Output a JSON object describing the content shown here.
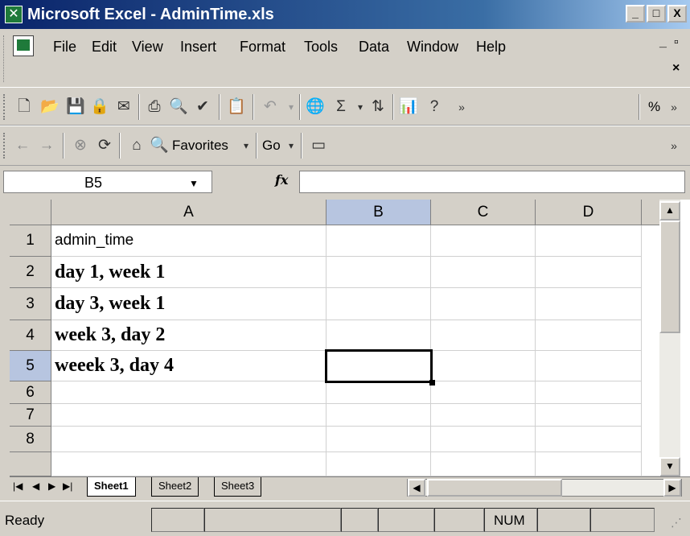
{
  "window": {
    "title": "Microsoft Excel - AdminTime.xls",
    "controls": [
      "_",
      "□",
      "X"
    ]
  },
  "menubar": {
    "items": [
      "File",
      "Edit",
      "View",
      "Insert",
      "Format",
      "Tools",
      "Data",
      "Window",
      "Help"
    ],
    "doc_controls": [
      "_ ",
      "▫",
      "×"
    ]
  },
  "toolbar_standard": {
    "icons": [
      "new-icon",
      "open-icon",
      "save-icon",
      "permission-icon",
      "email-icon",
      "print-icon",
      "print-preview-icon",
      "spelling-icon",
      "paste-icon",
      "undo-icon",
      "hyperlink-icon",
      "autosum-icon",
      "sort-ascending-icon",
      "chart-wizard-icon",
      "help-icon",
      "overflow-icon",
      "percent-icon"
    ],
    "percent_label": "%"
  },
  "toolbar_web": {
    "favorites_label": "Favorites",
    "go_label": "Go"
  },
  "formula_bar": {
    "cell_ref": "B5",
    "fx_label": "fx",
    "formula": ""
  },
  "sheet": {
    "columns": [
      "A",
      "B",
      "C",
      "D"
    ],
    "rows": [
      "1",
      "2",
      "3",
      "4",
      "5",
      "6",
      "7",
      "8"
    ],
    "cells": {
      "A1": "admin_time",
      "A2": "day 1, week 1",
      "A3": "day 3, week 1",
      "A4": "week 3, day 2",
      "A5": "weeek 3, day 4"
    },
    "active_cell": "B5",
    "selected_column": "B",
    "selected_row": "5"
  },
  "tabs": {
    "items": [
      "Sheet1",
      "Sheet2",
      "Sheet3"
    ],
    "active": "Sheet1"
  },
  "status": {
    "text": "Ready",
    "num": "NUM"
  }
}
